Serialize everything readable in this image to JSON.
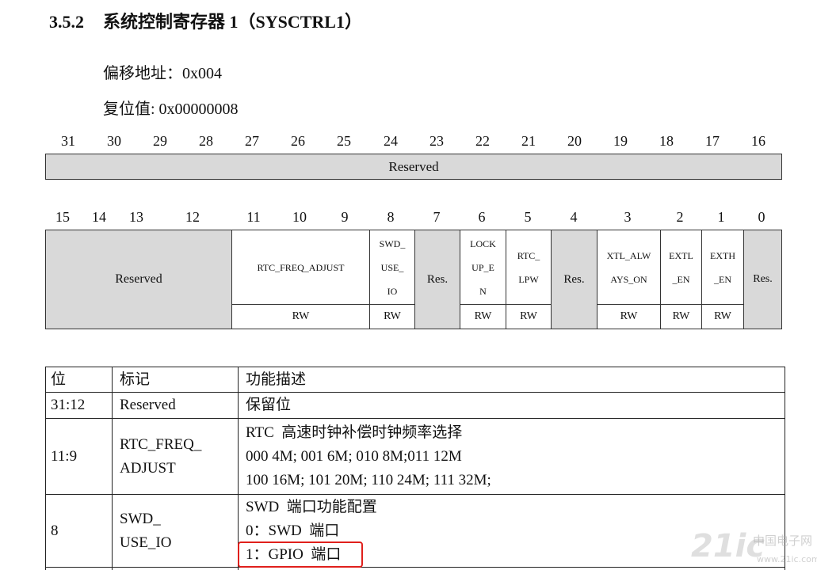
{
  "section": {
    "number": "3.5.2",
    "title": "系统控制寄存器 1（SYSCTRL1）"
  },
  "offset": "偏移地址：0x004",
  "reset_value": "复位值: 0x00000008",
  "register": {
    "high_bits": [
      "31",
      "30",
      "29",
      "28",
      "27",
      "26",
      "25",
      "24",
      "23",
      "22",
      "21",
      "20",
      "19",
      "18",
      "17",
      "16"
    ],
    "high_field": "Reserved",
    "low_bits": [
      "15",
      "14",
      "13",
      "12",
      "11",
      "10",
      "9",
      "8",
      "7",
      "6",
      "5",
      "4",
      "3",
      "2",
      "1",
      "0"
    ],
    "low_fields": [
      {
        "lines": [
          "Reserved"
        ],
        "reserved": true
      },
      {
        "lines": [
          "RTC_FREQ_ADJUST"
        ],
        "access": "RW"
      },
      {
        "lines": [
          "SWD_",
          "USE_",
          "IO"
        ],
        "access": "RW"
      },
      {
        "lines": [
          "Res."
        ],
        "reserved": true
      },
      {
        "lines": [
          "LOCK",
          "UP_E",
          "N"
        ],
        "access": "RW"
      },
      {
        "lines": [
          "RTC_",
          "LPW"
        ],
        "access": "RW"
      },
      {
        "lines": [
          "Res."
        ],
        "reserved": true
      },
      {
        "lines": [
          "XTL_ALW",
          "AYS_ON"
        ],
        "access": "RW"
      },
      {
        "lines": [
          "EXTL",
          "_EN"
        ],
        "access": "RW"
      },
      {
        "lines": [
          "EXTH",
          "_EN"
        ],
        "access": "RW"
      },
      {
        "lines": [
          "Res."
        ],
        "reserved": true
      }
    ],
    "reserved_fill": "#d9d9d9"
  },
  "description_table": {
    "headers": [
      "位",
      "标记",
      "功能描述"
    ],
    "rows": [
      {
        "bits": "31:12",
        "name": [
          "Reserved"
        ],
        "description": [
          "保留位"
        ]
      },
      {
        "bits": "11:9",
        "name": [
          "RTC_FREQ_",
          "ADJUST"
        ],
        "description": [
          "RTC  高速时钟补偿时钟频率选择",
          "000 4M; 001 6M; 010 8M;011 12M",
          "100 16M; 101 20M; 110 24M; 111 32M;"
        ]
      },
      {
        "bits": "8",
        "name": [
          "SWD_",
          "USE_IO"
        ],
        "description": [
          "SWD  端口功能配置",
          "0：SWD  端口",
          "1：GPIO  端口"
        ]
      }
    ],
    "highlight_color": "#e0201c"
  },
  "watermark": {
    "logo": "21ic",
    "name": "中国电子网",
    "url": "www.21ic.com"
  }
}
